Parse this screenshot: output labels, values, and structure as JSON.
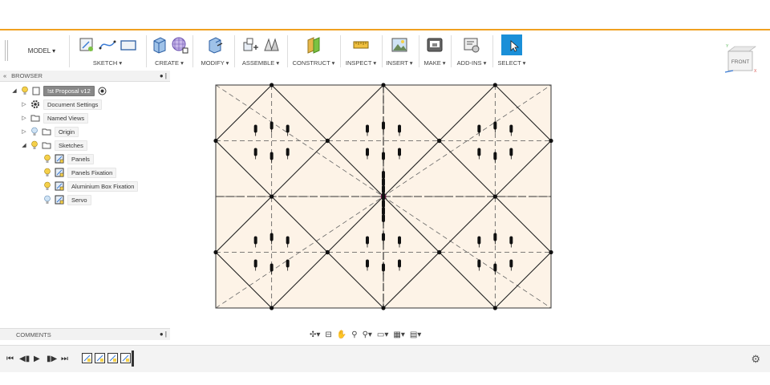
{
  "toolbar": {
    "workspace": "MODEL ▾",
    "groups": [
      {
        "label": "SKETCH ▾"
      },
      {
        "label": "CREATE ▾"
      },
      {
        "label": "MODIFY ▾"
      },
      {
        "label": "ASSEMBLE ▾"
      },
      {
        "label": "CONSTRUCT ▾"
      },
      {
        "label": "INSPECT ▾"
      },
      {
        "label": "INSERT ▾"
      },
      {
        "label": "MAKE ▾"
      },
      {
        "label": "ADD-INS ▾"
      },
      {
        "label": "SELECT ▾"
      }
    ]
  },
  "viewcube": {
    "face": "FRONT",
    "axis_x": "X",
    "axis_y": "Y"
  },
  "browser": {
    "title": "BROWSER",
    "collapse_icon": "«",
    "control": "● |",
    "root": "!st Proposal v12",
    "items": [
      {
        "label": "Document Settings",
        "icon": "gear-icon"
      },
      {
        "label": "Named Views",
        "icon": "folder-icon"
      },
      {
        "label": "Origin",
        "icon": "folder-icon"
      },
      {
        "label": "Sketches",
        "icon": "folder-icon"
      }
    ],
    "sketches": [
      {
        "label": "Panels"
      },
      {
        "label": "Panels Fixation"
      },
      {
        "label": "Aluminium Box Fixation"
      },
      {
        "label": "Servo"
      }
    ]
  },
  "comments": {
    "title": "COMMENTS",
    "control": "● |"
  },
  "colors": {
    "accent": "#f0a020",
    "sketch_fill": "#fdf3e7",
    "select_blue": "#1a8fd8"
  }
}
